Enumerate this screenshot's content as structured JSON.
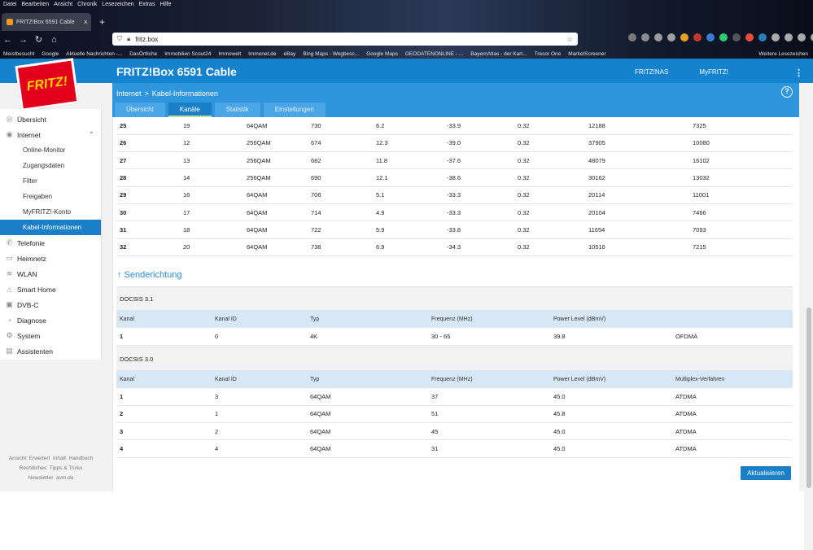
{
  "browser": {
    "menu": [
      "Datei",
      "Bearbeiten",
      "Ansicht",
      "Chronik",
      "Lesezeichen",
      "Extras",
      "Hilfe"
    ],
    "tab_title": "FRITZ!Box 6591 Cable",
    "url": "fritz.box",
    "bookmarks": [
      "Meistbesucht",
      "Google",
      "Aktuelle Nachrichten -...",
      "DasÖrtliche",
      "Immobilien Scout24",
      "Immowelt",
      "Immonet.de",
      "eBay",
      "Bing Maps - Wegbesc...",
      "Google Maps",
      "GEODATENONLINE - ...",
      "BayernAtlas - der Kart...",
      "Tresor One",
      "MarketScreener"
    ],
    "bookmarks_other": "Weitere Lesezeichen"
  },
  "header": {
    "product": "FRITZ!Box 6591 Cable",
    "logo": "FRITZ!",
    "nav": [
      "FRITZ!NAS",
      "MyFRITZ!"
    ]
  },
  "breadcrumb": {
    "parent": "Internet",
    "sep": ">",
    "current": "Kabel-Informationen"
  },
  "tabs": [
    "Übersicht",
    "Kanäle",
    "Statistik",
    "Einstellungen"
  ],
  "active_tab": "Kanäle",
  "sidebar": [
    {
      "label": "Übersicht",
      "icon": "home-icon",
      "level": 0
    },
    {
      "label": "Internet",
      "icon": "globe-icon",
      "level": 0,
      "expanded": true
    },
    {
      "label": "Online-Monitor",
      "level": 1
    },
    {
      "label": "Zugangsdaten",
      "level": 1
    },
    {
      "label": "Filter",
      "level": 1
    },
    {
      "label": "Freigaben",
      "level": 1
    },
    {
      "label": "MyFRITZ!-Konto",
      "level": 1
    },
    {
      "label": "Kabel-Informationen",
      "level": 1,
      "active": true
    },
    {
      "label": "Telefonie",
      "icon": "phone-icon",
      "level": 0
    },
    {
      "label": "Heimnetz",
      "icon": "network-icon",
      "level": 0
    },
    {
      "label": "WLAN",
      "icon": "wifi-icon",
      "level": 0
    },
    {
      "label": "Smart Home",
      "icon": "smarthome-icon",
      "level": 0
    },
    {
      "label": "DVB-C",
      "icon": "tv-icon",
      "level": 0
    },
    {
      "label": "Diagnose",
      "icon": "diagnose-icon",
      "level": 0
    },
    {
      "label": "System",
      "icon": "system-icon",
      "level": 0
    },
    {
      "label": "Assistenten",
      "icon": "wizard-icon",
      "level": 0
    }
  ],
  "footer": {
    "line1": [
      "Ansicht: Erweitert",
      "Inhalt",
      "Handbuch"
    ],
    "line2": [
      "Rechtliches",
      "Tipps & Tricks"
    ],
    "line3": [
      "Newsletter",
      "avm.de"
    ]
  },
  "downstream_rows": [
    [
      "25",
      "19",
      "64QAM",
      "730",
      "6.2",
      "-33.9",
      "0.32",
      "12188",
      "7325"
    ],
    [
      "26",
      "12",
      "256QAM",
      "674",
      "12.3",
      "-39.0",
      "0.32",
      "37905",
      "10080"
    ],
    [
      "27",
      "13",
      "256QAM",
      "682",
      "11.8",
      "-37.6",
      "0.32",
      "48079",
      "16102"
    ],
    [
      "28",
      "14",
      "256QAM",
      "690",
      "12.1",
      "-38.6",
      "0.32",
      "30162",
      "13032"
    ],
    [
      "29",
      "16",
      "64QAM",
      "706",
      "5.1",
      "-33.3",
      "0.32",
      "20114",
      "11001"
    ],
    [
      "30",
      "17",
      "64QAM",
      "714",
      "4.9",
      "-33.3",
      "0.32",
      "20104",
      "7466"
    ],
    [
      "31",
      "18",
      "64QAM",
      "722",
      "5.9",
      "-33.8",
      "0.32",
      "11654",
      "7093"
    ],
    [
      "32",
      "20",
      "64QAM",
      "738",
      "6.9",
      "-34.3",
      "0.32",
      "10516",
      "7215"
    ]
  ],
  "upstream": {
    "heading": "↑ Senderichtung",
    "docsis31": {
      "title": "DOCSIS 3.1",
      "columns": [
        "Kanal",
        "Kanal ID",
        "Typ",
        "Frequenz (MHz)",
        "Power Level (dBmV)",
        ""
      ],
      "rows": [
        [
          "1",
          "0",
          "4K",
          "30 - 65",
          "39.8",
          "OFDMA"
        ]
      ]
    },
    "docsis30": {
      "title": "DOCSIS 3.0",
      "columns": [
        "Kanal",
        "Kanal ID",
        "Typ",
        "Frequenz (MHz)",
        "Power Level (dBmV)",
        "Multiplex-Verfahren"
      ],
      "rows": [
        [
          "1",
          "3",
          "64QAM",
          "37",
          "45.0",
          "ATDMA"
        ],
        [
          "2",
          "1",
          "64QAM",
          "51",
          "45.8",
          "ATDMA"
        ],
        [
          "3",
          "2",
          "64QAM",
          "45",
          "45.0",
          "ATDMA"
        ],
        [
          "4",
          "4",
          "64QAM",
          "31",
          "45.0",
          "ATDMA"
        ]
      ]
    }
  },
  "refresh_label": "Aktualisieren"
}
